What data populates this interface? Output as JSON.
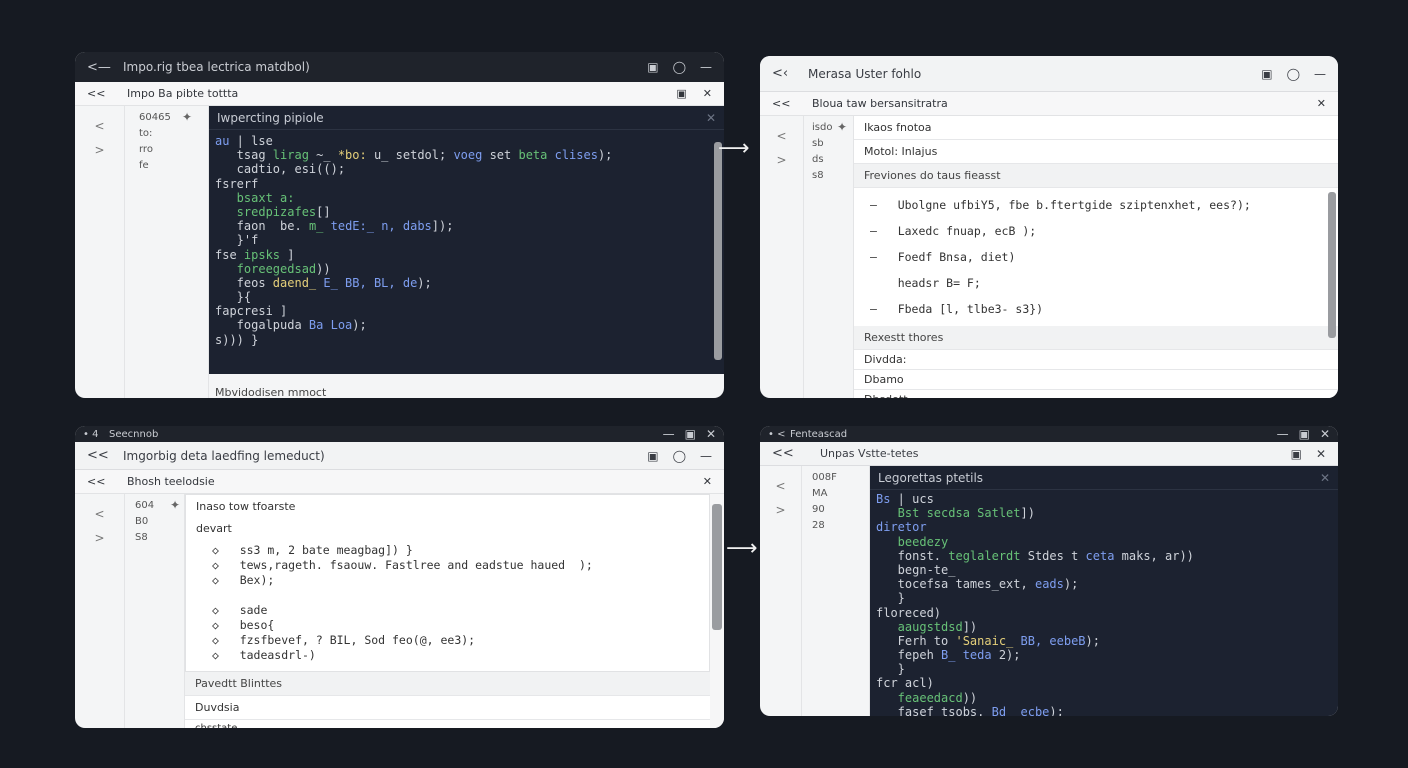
{
  "windows": {
    "tl": {
      "title": "Impo.rig tbea lectrica matdbol)",
      "tab": "Impo Ba pibte tottta",
      "left_nav": [
        "<",
        ">"
      ],
      "gutter": [
        "60465",
        "to:",
        "rro",
        "fe"
      ],
      "code_head": "Iwpercting pipiole",
      "code": [
        [
          [
            "c-b",
            "au"
          ],
          [
            "c-w",
            " | lse"
          ]
        ],
        [
          [
            "c-w",
            "   tsag "
          ],
          [
            "c-g",
            "lirag"
          ],
          [
            "c-w",
            " ~_ "
          ],
          [
            "c-y",
            "*bo:"
          ],
          [
            "c-w",
            " u_ "
          ],
          [
            "c-w",
            "setdol;"
          ],
          [
            "c-b",
            " voeg"
          ],
          [
            "c-w",
            " set "
          ],
          [
            "c-g",
            "beta"
          ],
          [
            "c-b",
            " clises"
          ],
          [
            "c-w",
            ");"
          ]
        ],
        [
          [
            "c-w",
            "   cadtio, "
          ],
          [
            "c-w",
            "esi(();"
          ]
        ],
        [
          [
            "c-w",
            "fsrerf"
          ]
        ],
        [
          [
            "c-g",
            "   bsaxt a:"
          ]
        ],
        [
          [
            "c-g",
            "   sredpizafes"
          ],
          [
            "c-w",
            "[]"
          ]
        ],
        [
          [
            "c-w",
            "   faon  "
          ],
          [
            "c-w",
            "be. "
          ],
          [
            "c-g",
            "m_ "
          ],
          [
            "c-b",
            "tedE:_ n, "
          ],
          [
            "c-b",
            "dabs"
          ],
          [
            "c-w",
            "]);"
          ]
        ],
        [
          [
            "c-w",
            "   }'f"
          ]
        ],
        [
          [
            "c-w",
            "fse "
          ],
          [
            "c-g",
            "ipsks"
          ],
          [
            "c-w",
            " ]"
          ]
        ],
        [
          [
            "c-g",
            "   foreegedsad"
          ],
          [
            "c-w",
            "))"
          ]
        ],
        [
          [
            "c-w",
            "   feos "
          ],
          [
            "c-y",
            "daend_ "
          ],
          [
            "c-b",
            "E_ BB, BL, de"
          ],
          [
            "c-w",
            ");"
          ]
        ],
        [
          [
            "c-w",
            "   }{"
          ]
        ],
        [
          [
            "c-w",
            "fapcresi ]"
          ]
        ],
        [
          [
            "c-w",
            "   fogalpuda "
          ],
          [
            "c-b",
            "Ba Loa"
          ],
          [
            "c-w",
            ");"
          ]
        ],
        [
          [
            "c-w",
            "s))) }"
          ]
        ]
      ],
      "footer": "Mbvidodisen mmoct"
    },
    "tr": {
      "title": "Merasa Uster fohlo",
      "tab": "Bloua taw bersansitratra",
      "left_nav": [
        "<",
        ">"
      ],
      "gutter": [
        "isdo",
        "sb",
        "ds",
        "s8"
      ],
      "doc_rows": [
        "Ikaos fnotoa",
        "Motol: Inlajus"
      ],
      "section": "Freviones do taus fieasst",
      "bullets": [
        "–   Ubolgne ufbiY5, fbe b.ftertgide sziptenxhet, ees?);",
        "–   Laxedc fnuap, ecB );",
        "–   Foedf Bnsa, diet)",
        "    headsr B= F;",
        "–   Fbeda [l, tlbe3- s3})"
      ],
      "sub_section": "Rexestt thores",
      "lower_rows": [
        "Divdda:",
        "Dbamo",
        "Dbsdott"
      ]
    },
    "bl": {
      "titlebar_small": "Seecnnob",
      "title": "Imgorbig deta laedfing lemeduct)",
      "tab": "Bhosh teelodsie",
      "left_nav": [
        "<",
        ">"
      ],
      "gutter": [
        "604",
        "B0",
        "S8"
      ],
      "doc_head": "Inaso tow tfoarste",
      "doc_sub": "devart",
      "bullets": [
        "◇   ss3 m, 2 bate meagbag]) }",
        "◇   tews,rageth. fsaouw. Fastlree and eadstue haued  );",
        "◇   Bex);",
        "",
        "◇   sade",
        "◇   beso{",
        "◇   fzsfbevef, ? BIL, Sod feo(@, ee3);",
        "◇   tadeasdrl-)"
      ],
      "section": "Pavedtt  Blinttes",
      "lower_rows": [
        "Duvdsia",
        "chsstate"
      ]
    },
    "br": {
      "titlebar_small": "Fenteascad",
      "title": "Unpas Vstte-tetes",
      "left_nav": [
        "<",
        ">"
      ],
      "gutter": [
        "008F",
        "MA",
        "90",
        "28"
      ],
      "code_head": "Legorettas ptetils",
      "code": [
        [
          [
            "c-b",
            "Bs"
          ],
          [
            "c-w",
            " | "
          ],
          [
            "c-w",
            "ucs"
          ]
        ],
        [
          [
            "c-g",
            "   Bst secdsa Satlet"
          ],
          [
            "c-w",
            "])"
          ]
        ],
        [
          [
            "c-b",
            "diretor"
          ]
        ],
        [
          [
            "c-g",
            "   beedezy"
          ]
        ],
        [
          [
            "c-w",
            "   fonst. "
          ],
          [
            "c-g",
            "teglalerdt"
          ],
          [
            "c-w",
            " Stdes t "
          ],
          [
            "c-b",
            "ceta"
          ],
          [
            "c-w",
            " maks, ar))"
          ]
        ],
        [
          [
            "c-w",
            "   begn-te_"
          ]
        ],
        [
          [
            "c-w",
            "   tocefsa "
          ],
          [
            "c-w",
            "tames_ext, "
          ],
          [
            "c-b",
            "eads"
          ],
          [
            "c-w",
            ");"
          ]
        ],
        [
          [
            "c-w",
            "   }"
          ]
        ],
        [
          [
            "c-w",
            "floreced)"
          ]
        ],
        [
          [
            "c-g",
            "   aaugstdsd"
          ],
          [
            "c-w",
            "])"
          ]
        ],
        [
          [
            "c-w",
            "   Ferh to "
          ],
          [
            "c-y",
            "'Sanaic_"
          ],
          [
            "c-b",
            " BB, "
          ],
          [
            "c-b",
            "eebeB"
          ],
          [
            "c-w",
            ");"
          ]
        ],
        [
          [
            "c-w",
            "   fepeh "
          ],
          [
            "c-b",
            "B_ teda"
          ],
          [
            "c-w",
            " 2);"
          ]
        ],
        [
          [
            "c-w",
            "   }"
          ]
        ],
        [
          [
            "c-w",
            "fcr acl)"
          ]
        ],
        [
          [
            "c-g",
            "   feaeedacd"
          ],
          [
            "c-w",
            "))"
          ]
        ],
        [
          [
            "c-w",
            "   fasef tsobs. "
          ],
          [
            "c-b",
            "Bd_ ecbe"
          ],
          [
            "c-w",
            ");"
          ]
        ]
      ]
    }
  }
}
